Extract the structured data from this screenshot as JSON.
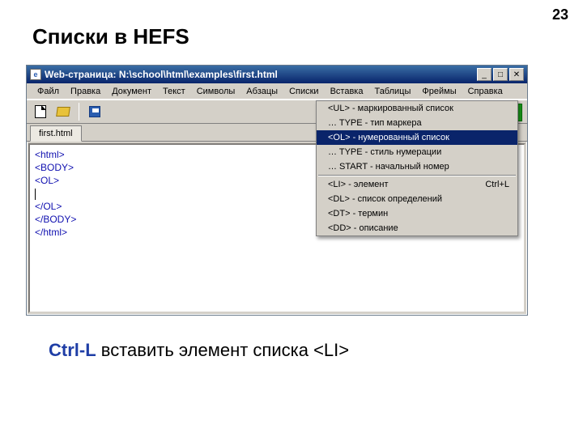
{
  "slide": {
    "number": "23",
    "title": "Списки в HEFS"
  },
  "window": {
    "title": "Web-страница: N:\\school\\html\\examples\\first.html",
    "app_icon": "e"
  },
  "menus": [
    "Файл",
    "Правка",
    "Документ",
    "Текст",
    "Символы",
    "Абзацы",
    "Списки",
    "Вставка",
    "Таблицы",
    "Фреймы",
    "Справка"
  ],
  "tab": "first.html",
  "code_lines": [
    "<html>",
    "<BODY>",
    "<OL>",
    "",
    "</OL>",
    "</BODY>",
    "</html>"
  ],
  "dropdown": {
    "items": [
      {
        "label": "<UL> - маркированный список",
        "shortcut": "",
        "selected": false
      },
      {
        "label": "… TYPE - тип маркера",
        "shortcut": "",
        "selected": false
      },
      {
        "label": "<OL> - нумерованный список",
        "shortcut": "",
        "selected": true
      },
      {
        "label": "… TYPE - стиль нумерации",
        "shortcut": "",
        "selected": false
      },
      {
        "label": "… START - начальный номер",
        "shortcut": "",
        "selected": false
      },
      {
        "label": "<LI> - элемент",
        "shortcut": "Ctrl+L",
        "selected": false
      },
      {
        "label": "<DL> - список определений",
        "shortcut": "",
        "selected": false
      },
      {
        "label": "<DT> - термин",
        "shortcut": "",
        "selected": false
      },
      {
        "label": "<DD> - описание",
        "shortcut": "",
        "selected": false
      }
    ]
  },
  "caption": {
    "hotkey": "Ctrl-L",
    "text": " вставить элемент списка <LI>"
  },
  "win_buttons": {
    "min": "_",
    "max": "□",
    "close": "✕"
  },
  "go_arrow": "→"
}
